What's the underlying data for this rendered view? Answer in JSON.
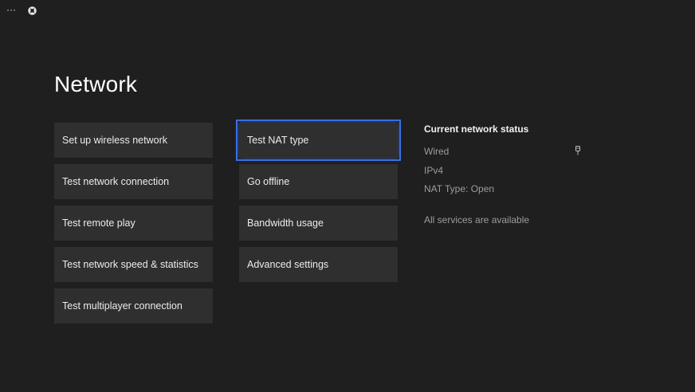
{
  "topbar": {
    "more_label": "···",
    "logo_icon": "xbox-logo-icon"
  },
  "page": {
    "title": "Network"
  },
  "left_menu": {
    "items": [
      {
        "label": "Set up wireless network"
      },
      {
        "label": "Test network connection"
      },
      {
        "label": "Test remote play"
      },
      {
        "label": "Test network speed & statistics"
      },
      {
        "label": "Test multiplayer connection"
      }
    ]
  },
  "mid_menu": {
    "items": [
      {
        "label": "Test NAT type",
        "focused": true
      },
      {
        "label": "Go offline"
      },
      {
        "label": "Bandwidth usage"
      },
      {
        "label": "Advanced settings"
      }
    ]
  },
  "status": {
    "heading": "Current network status",
    "connection": "Wired",
    "connection_icon": "ethernet-plug-icon",
    "ip_version": "IPv4",
    "nat_type": "NAT Type: Open",
    "services": "All services are available"
  },
  "colors": {
    "background": "#1f1f1f",
    "tile": "#2f2f2f",
    "focus": "#3b6fe0"
  }
}
